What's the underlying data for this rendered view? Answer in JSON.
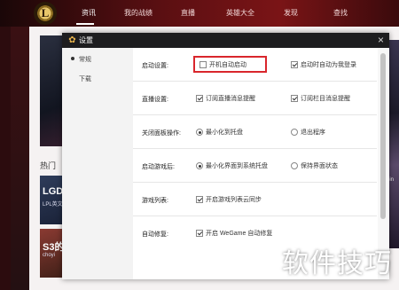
{
  "app": {
    "logo_letter": "L",
    "nav": [
      "资讯",
      "我的战绩",
      "直播",
      "英雄大全",
      "发现",
      "查找"
    ],
    "hot_label": "热门",
    "cards": [
      {
        "title": "LGD",
        "subtitle": "LPL英文"
      },
      {
        "title": "S3的",
        "subtitle": "choyi"
      }
    ],
    "side_texts": [
      "oin",
      "3"
    ]
  },
  "dialog": {
    "title": "设置",
    "close_icon": "×",
    "nav": [
      "常规",
      "下载"
    ],
    "rows": [
      {
        "label": "启动设置:",
        "options": [
          {
            "type": "checkbox",
            "text": "开机自动启动",
            "checked": false
          },
          {
            "type": "checkbox",
            "text": "启动时自动为我登录",
            "checked": true
          }
        ]
      },
      {
        "label": "直播设置:",
        "options": [
          {
            "type": "checkbox",
            "text": "订阅直播消息提醒",
            "checked": true
          },
          {
            "type": "checkbox",
            "text": "订阅栏目消息提醒",
            "checked": true
          }
        ]
      },
      {
        "label": "关闭面板操作:",
        "options": [
          {
            "type": "radio",
            "text": "最小化到托盘",
            "checked": true
          },
          {
            "type": "radio",
            "text": "退出程序",
            "checked": false
          }
        ]
      },
      {
        "label": "启动游戏后:",
        "options": [
          {
            "type": "radio",
            "text": "最小化界面到系统托盘",
            "checked": true
          },
          {
            "type": "radio",
            "text": "保持界面状态",
            "checked": false
          }
        ]
      },
      {
        "label": "游戏列表:",
        "options": [
          {
            "type": "checkbox",
            "text": "开启游戏列表云同步",
            "checked": true
          }
        ]
      },
      {
        "label": "自动修复:",
        "options": [
          {
            "type": "checkbox",
            "text": "开启 WeGame 自动修复",
            "checked": true
          }
        ]
      }
    ]
  },
  "watermark": "软件技巧",
  "colors": {
    "highlight": "#d9262c",
    "header": "#1d1d1f",
    "gear": "#e9b44c"
  }
}
